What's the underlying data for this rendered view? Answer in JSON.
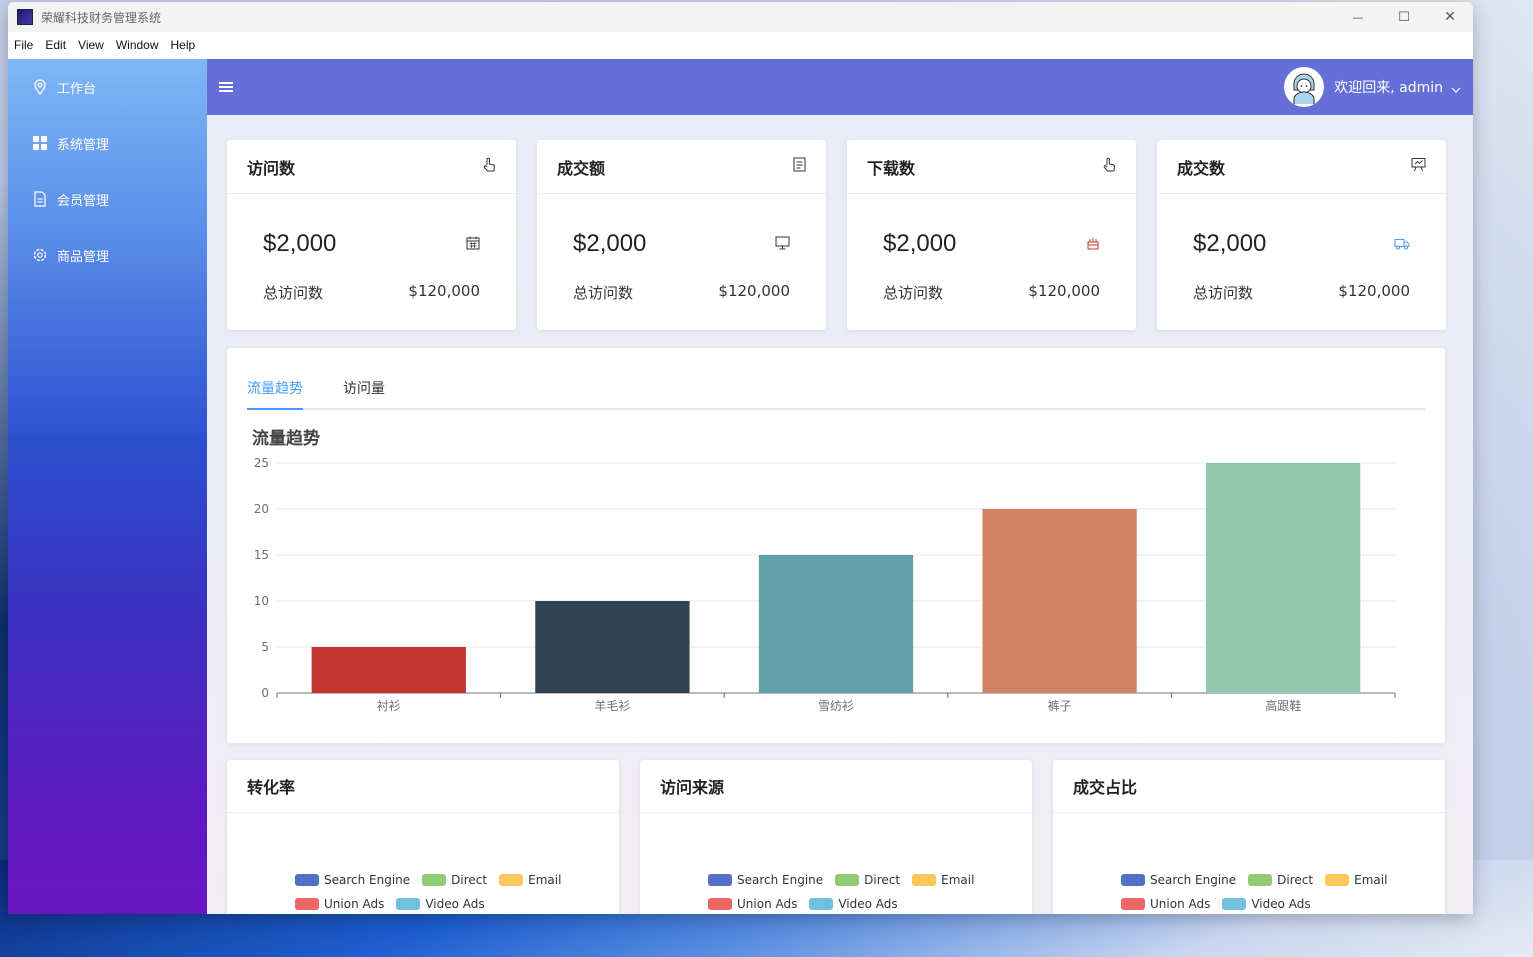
{
  "window": {
    "title": "荣耀科技财务管理系统",
    "controls": {
      "minimize": "—",
      "maximize": "☐",
      "close": "✕"
    }
  },
  "menubar": [
    "File",
    "Edit",
    "View",
    "Window",
    "Help"
  ],
  "sidebar": {
    "items": [
      {
        "label": "工作台",
        "icon": "location-pin-icon"
      },
      {
        "label": "系统管理",
        "icon": "grid-icon"
      },
      {
        "label": "会员管理",
        "icon": "document-icon"
      },
      {
        "label": "商品管理",
        "icon": "gear-icon"
      }
    ]
  },
  "header": {
    "welcome": "欢迎回来, admin"
  },
  "cards": [
    {
      "title": "访问数",
      "icon": "pointer-hand-icon",
      "amount": "$2,000",
      "amount_icon": "calendar-icon",
      "stat_label": "总访问数",
      "stat_value": "$120,000"
    },
    {
      "title": "成交额",
      "icon": "receipt-icon",
      "amount": "$2,000",
      "amount_icon": "monitor-icon",
      "stat_label": "总访问数",
      "stat_value": "$120,000"
    },
    {
      "title": "下载数",
      "icon": "pointer-hand-icon",
      "amount": "$2,000",
      "amount_icon": "cake-icon",
      "stat_label": "总访问数",
      "stat_value": "$120,000"
    },
    {
      "title": "成交数",
      "icon": "presentation-icon",
      "amount": "$2,000",
      "amount_icon": "truck-icon",
      "stat_label": "总访问数",
      "stat_value": "$120,000"
    }
  ],
  "tabs": [
    {
      "label": "流量趋势",
      "active": true
    },
    {
      "label": "访问量",
      "active": false
    }
  ],
  "chart_data": {
    "type": "bar",
    "title": "流量趋势",
    "categories": [
      "衬衫",
      "羊毛衫",
      "雪纺衫",
      "裤子",
      "高跟鞋"
    ],
    "values": [
      5,
      10,
      15,
      20,
      25
    ],
    "colors": [
      "#c23531",
      "#2f4554",
      "#61a0a8",
      "#d48265",
      "#91c7ae"
    ],
    "ylim": [
      0,
      25
    ],
    "yticks": [
      0,
      5,
      10,
      15,
      20,
      25
    ],
    "grid": true
  },
  "bottom_cards": [
    {
      "title": "转化率"
    },
    {
      "title": "访问来源"
    },
    {
      "title": "成交占比"
    }
  ],
  "legend": {
    "row1": [
      {
        "label": "Search Engine",
        "color": "#5470c6"
      },
      {
        "label": "Direct",
        "color": "#91cc75"
      },
      {
        "label": "Email",
        "color": "#fac858"
      }
    ],
    "row2": [
      {
        "label": "Union Ads",
        "color": "#ee6666"
      },
      {
        "label": "Video Ads",
        "color": "#73c0de"
      }
    ]
  }
}
